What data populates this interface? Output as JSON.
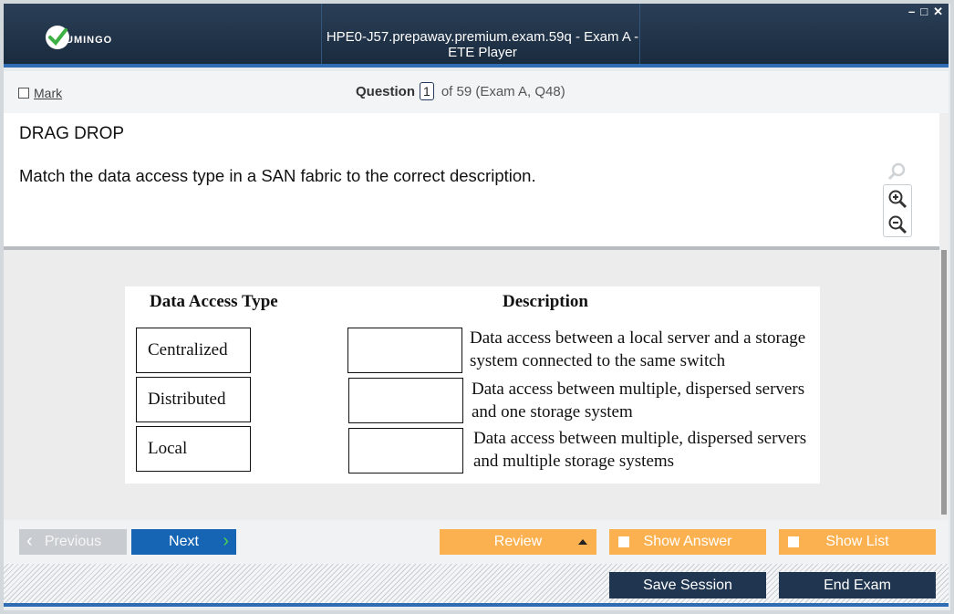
{
  "window": {
    "title": "HPE0-J57.prepaway.premium.exam.59q - Exam A - ETE Player",
    "logo_text": "UMINGO",
    "controls": {
      "minimize": "–",
      "maximize": "□",
      "close": "✕"
    }
  },
  "question_bar": {
    "mark_label": "Mark",
    "question_label": "Question",
    "question_number": "1",
    "question_suffix": "of 59 (Exam A, Q48)"
  },
  "question": {
    "type": "DRAG DROP",
    "text": "Match the data access type in a SAN fabric to the correct description.",
    "zoom_icons": [
      "magnifier-icon",
      "zoom-in-icon",
      "zoom-out-icon"
    ]
  },
  "exhibit": {
    "header_type": "Data Access Type",
    "header_description": "Description",
    "types": [
      "Centralized",
      "Distributed",
      "Local"
    ],
    "descriptions": [
      {
        "line1": "Data access between a local server and a storage",
        "line2": "system connected to the same switch"
      },
      {
        "line1": "Data access between multiple, dispersed servers",
        "line2": "and one storage system"
      },
      {
        "line1": "Data access between multiple, dispersed servers",
        "line2": "and multiple storage systems"
      }
    ]
  },
  "navigation": {
    "previous": "Previous",
    "next": "Next",
    "review": "Review",
    "show_answer": "Show Answer",
    "show_list": "Show List"
  },
  "footer": {
    "save_session": "Save Session",
    "end_exam": "End Exam"
  },
  "colors": {
    "titlebar": "#1f3550",
    "accent_blue": "#1565b4",
    "orange": "#fbb150",
    "check_green": "#4fd34f"
  }
}
